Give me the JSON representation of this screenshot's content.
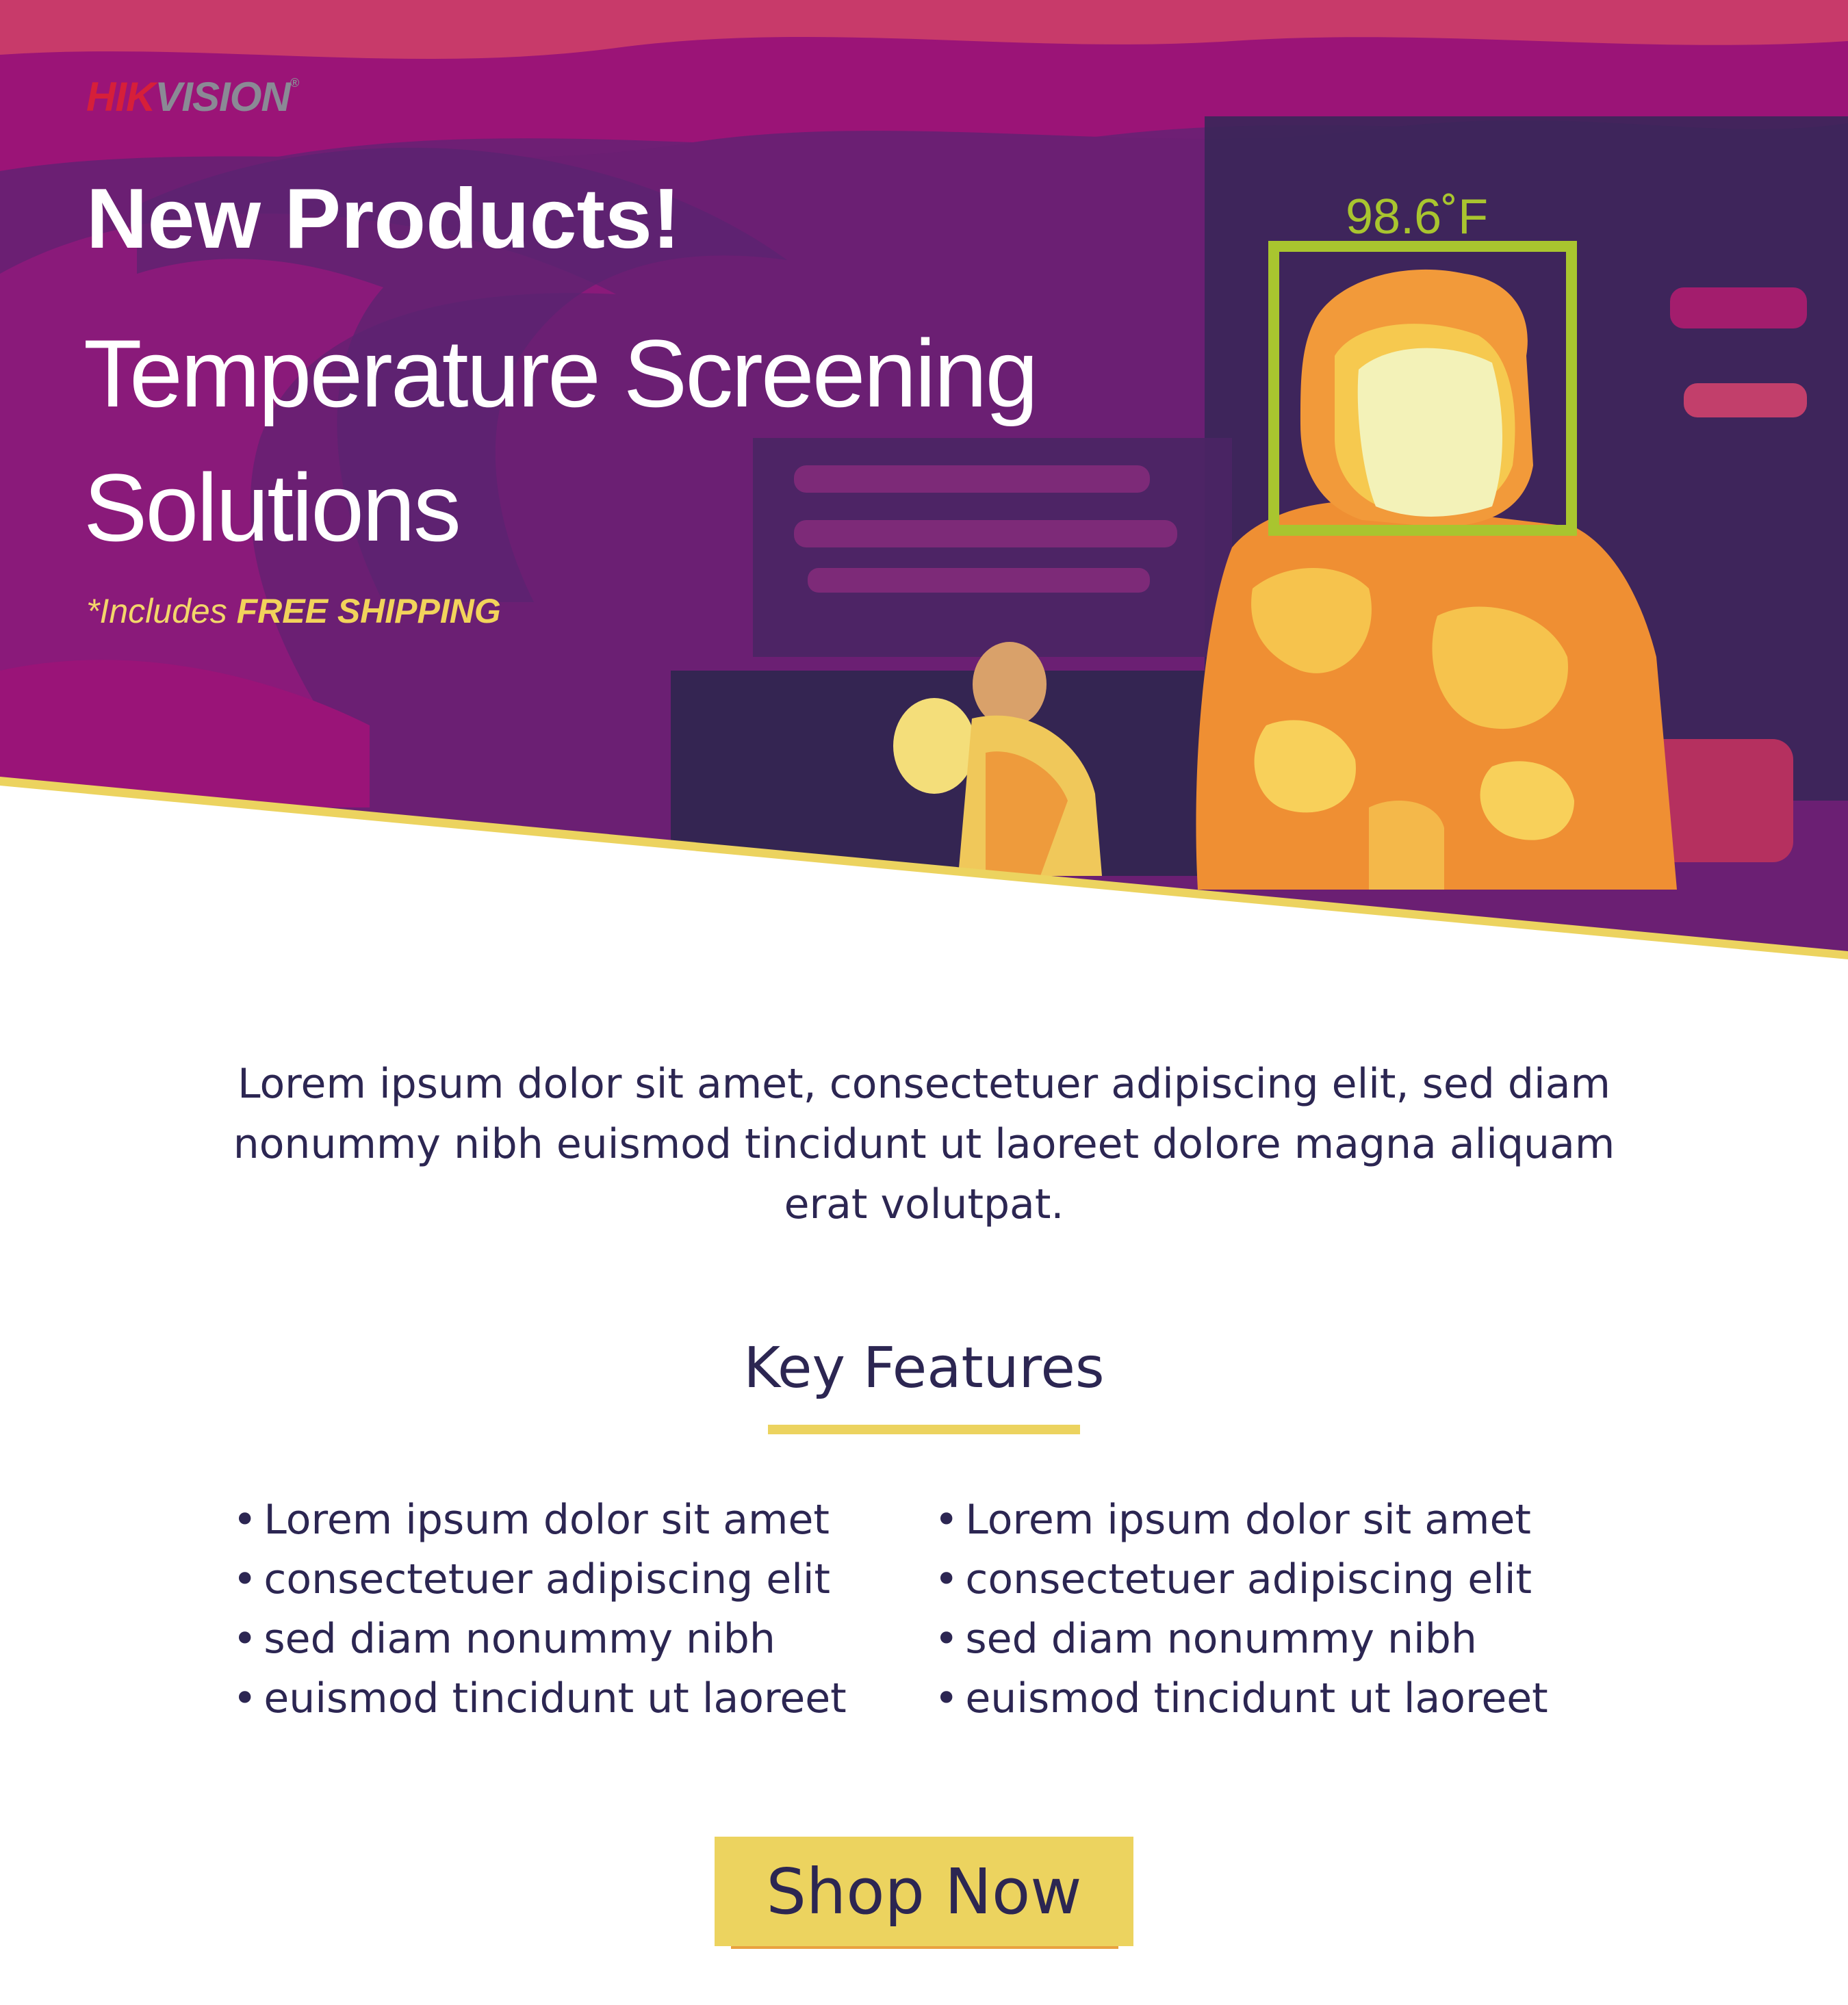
{
  "brand": {
    "part1": "HIK",
    "part2": "VISION",
    "mark": "®"
  },
  "hero": {
    "headline": "New Products!",
    "subhead": "Temperature Screening Solutions",
    "shipping_prefix": "*Includes ",
    "shipping_emphasis": "FREE SHIPPING",
    "temperature_reading": "98.6˚F"
  },
  "intro": "Lorem ipsum dolor sit amet, consectetuer adipiscing elit, sed diam nonummy nibh euismod tincidunt ut laoreet dolore magna aliquam erat volutpat.",
  "features": {
    "title": "Key Features",
    "left": [
      "Lorem ipsum dolor sit amet",
      "consectetuer adipiscing elit",
      "sed diam nonummy nibh",
      "euismod tincidunt ut laoreet"
    ],
    "right": [
      "Lorem ipsum dolor sit amet",
      "consectetuer adipiscing elit",
      "sed diam nonummy nibh",
      "euismod tincidunt ut laoreet"
    ]
  },
  "cta": {
    "label": "Shop Now"
  },
  "colors": {
    "navy": "#2c2652",
    "yellow": "#ecd35f",
    "orange": "#e9a23f",
    "purple": "#7b1d7e",
    "magenta": "#9a1478",
    "detection_green": "#a9c52f",
    "brand_red": "#d61f3a"
  }
}
